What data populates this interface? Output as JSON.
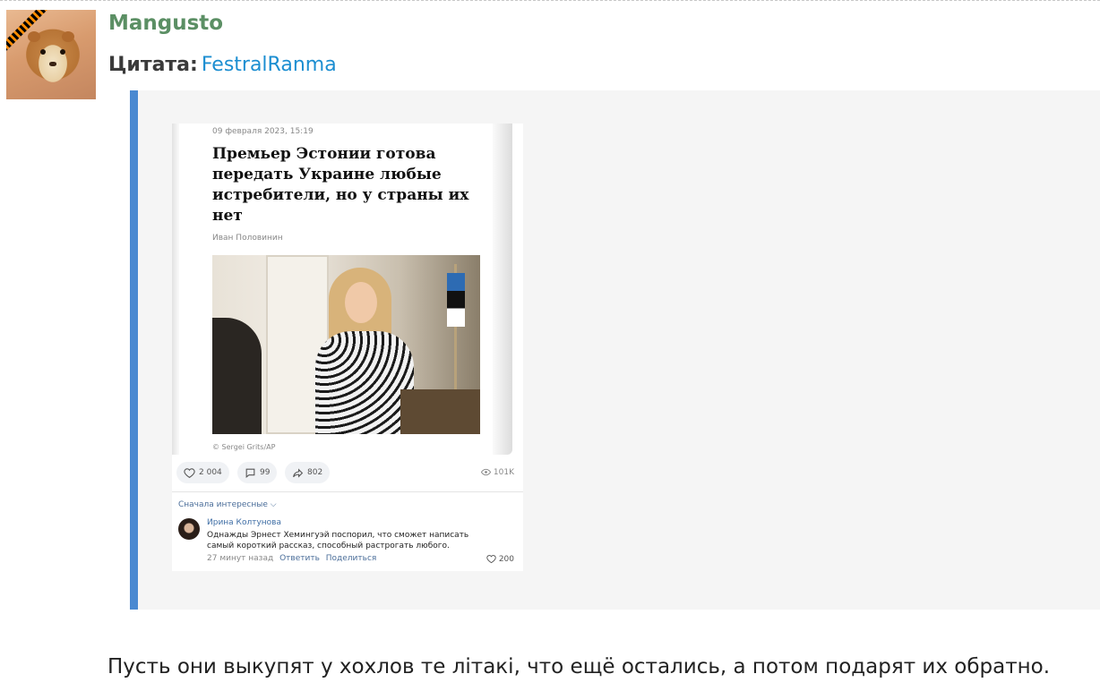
{
  "post": {
    "username": "Mangusto",
    "quote_label": "Цитата:",
    "quoted_user": "FestralRanma",
    "body": "Пусть они выкупят у хохлов те літакі, что ещё остались, а потом подарят их обратно."
  },
  "embed": {
    "date": "09 февраля 2023, 15:19",
    "title": "Премьер Эстонии готова передать Украине любые истребители, но у страны их нет",
    "author": "Иван Половинин",
    "photo_credit": "© Sergei Grits/AP",
    "likes": "2 004",
    "comments": "99",
    "shares": "802",
    "views": "101K",
    "sort_label": "Сначала интересные",
    "comment": {
      "author": "Ирина Колтунова",
      "text": "Однажды Эрнест Хемингуэй поспорил, что сможет написать самый короткий рассказ, способный растрогать любого.",
      "time": "27 минут назад",
      "reply": "Ответить",
      "share": "Поделиться",
      "likes": "200"
    }
  },
  "colors": {
    "username": "#5b8f64",
    "link": "#1c8ed1",
    "quote_bar": "#4a89d1",
    "quote_bg": "#f5f5f5"
  }
}
